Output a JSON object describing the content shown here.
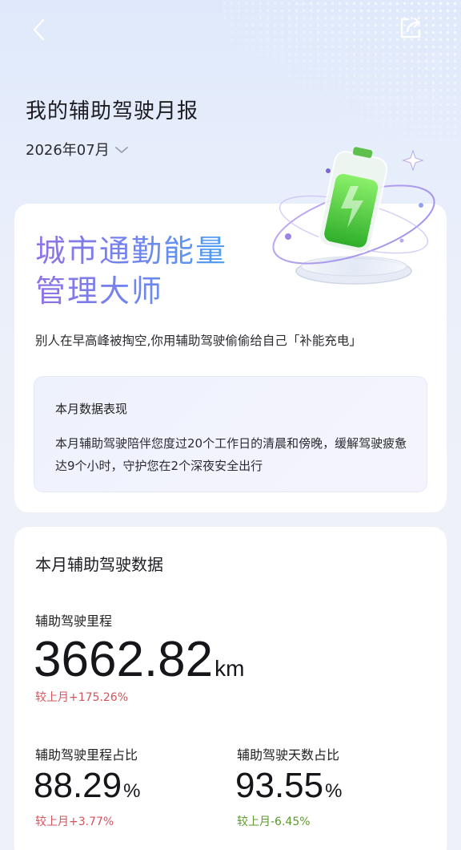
{
  "header": {
    "title": "我的辅助驾驶月报",
    "month": "2026年07月"
  },
  "highlight_card": {
    "headline_line1": "城市通勤能量",
    "headline_line2": "管理大师",
    "subtitle": "别人在早高峰被掏空,你用辅助驾驶偷偷给自己「补能充电」",
    "summary": {
      "title": "本月数据表现",
      "text": "本月辅助驾驶陪伴您度过20个工作日的清晨和傍晚，缓解驾驶疲惫达9个小时，守护您在2个深夜安全出行"
    }
  },
  "stats_card": {
    "title": "本月辅助驾驶数据",
    "mileage": {
      "label": "辅助驾驶里程",
      "value": "3662.82",
      "unit": "km",
      "delta": "较上月+175.26%"
    },
    "mileage_ratio": {
      "label": "辅助驾驶里程占比",
      "value": "88.29",
      "unit": "%",
      "delta": "较上月+3.77%"
    },
    "days_ratio": {
      "label": "辅助驾驶天数占比",
      "value": "93.55",
      "unit": "%",
      "delta": "较上月-6.45%"
    }
  },
  "colors": {
    "increase": "#d0555b",
    "decrease": "#5b9a2a",
    "headline_gradient_start": "#8f72e6",
    "headline_gradient_end": "#4fa0f3"
  }
}
